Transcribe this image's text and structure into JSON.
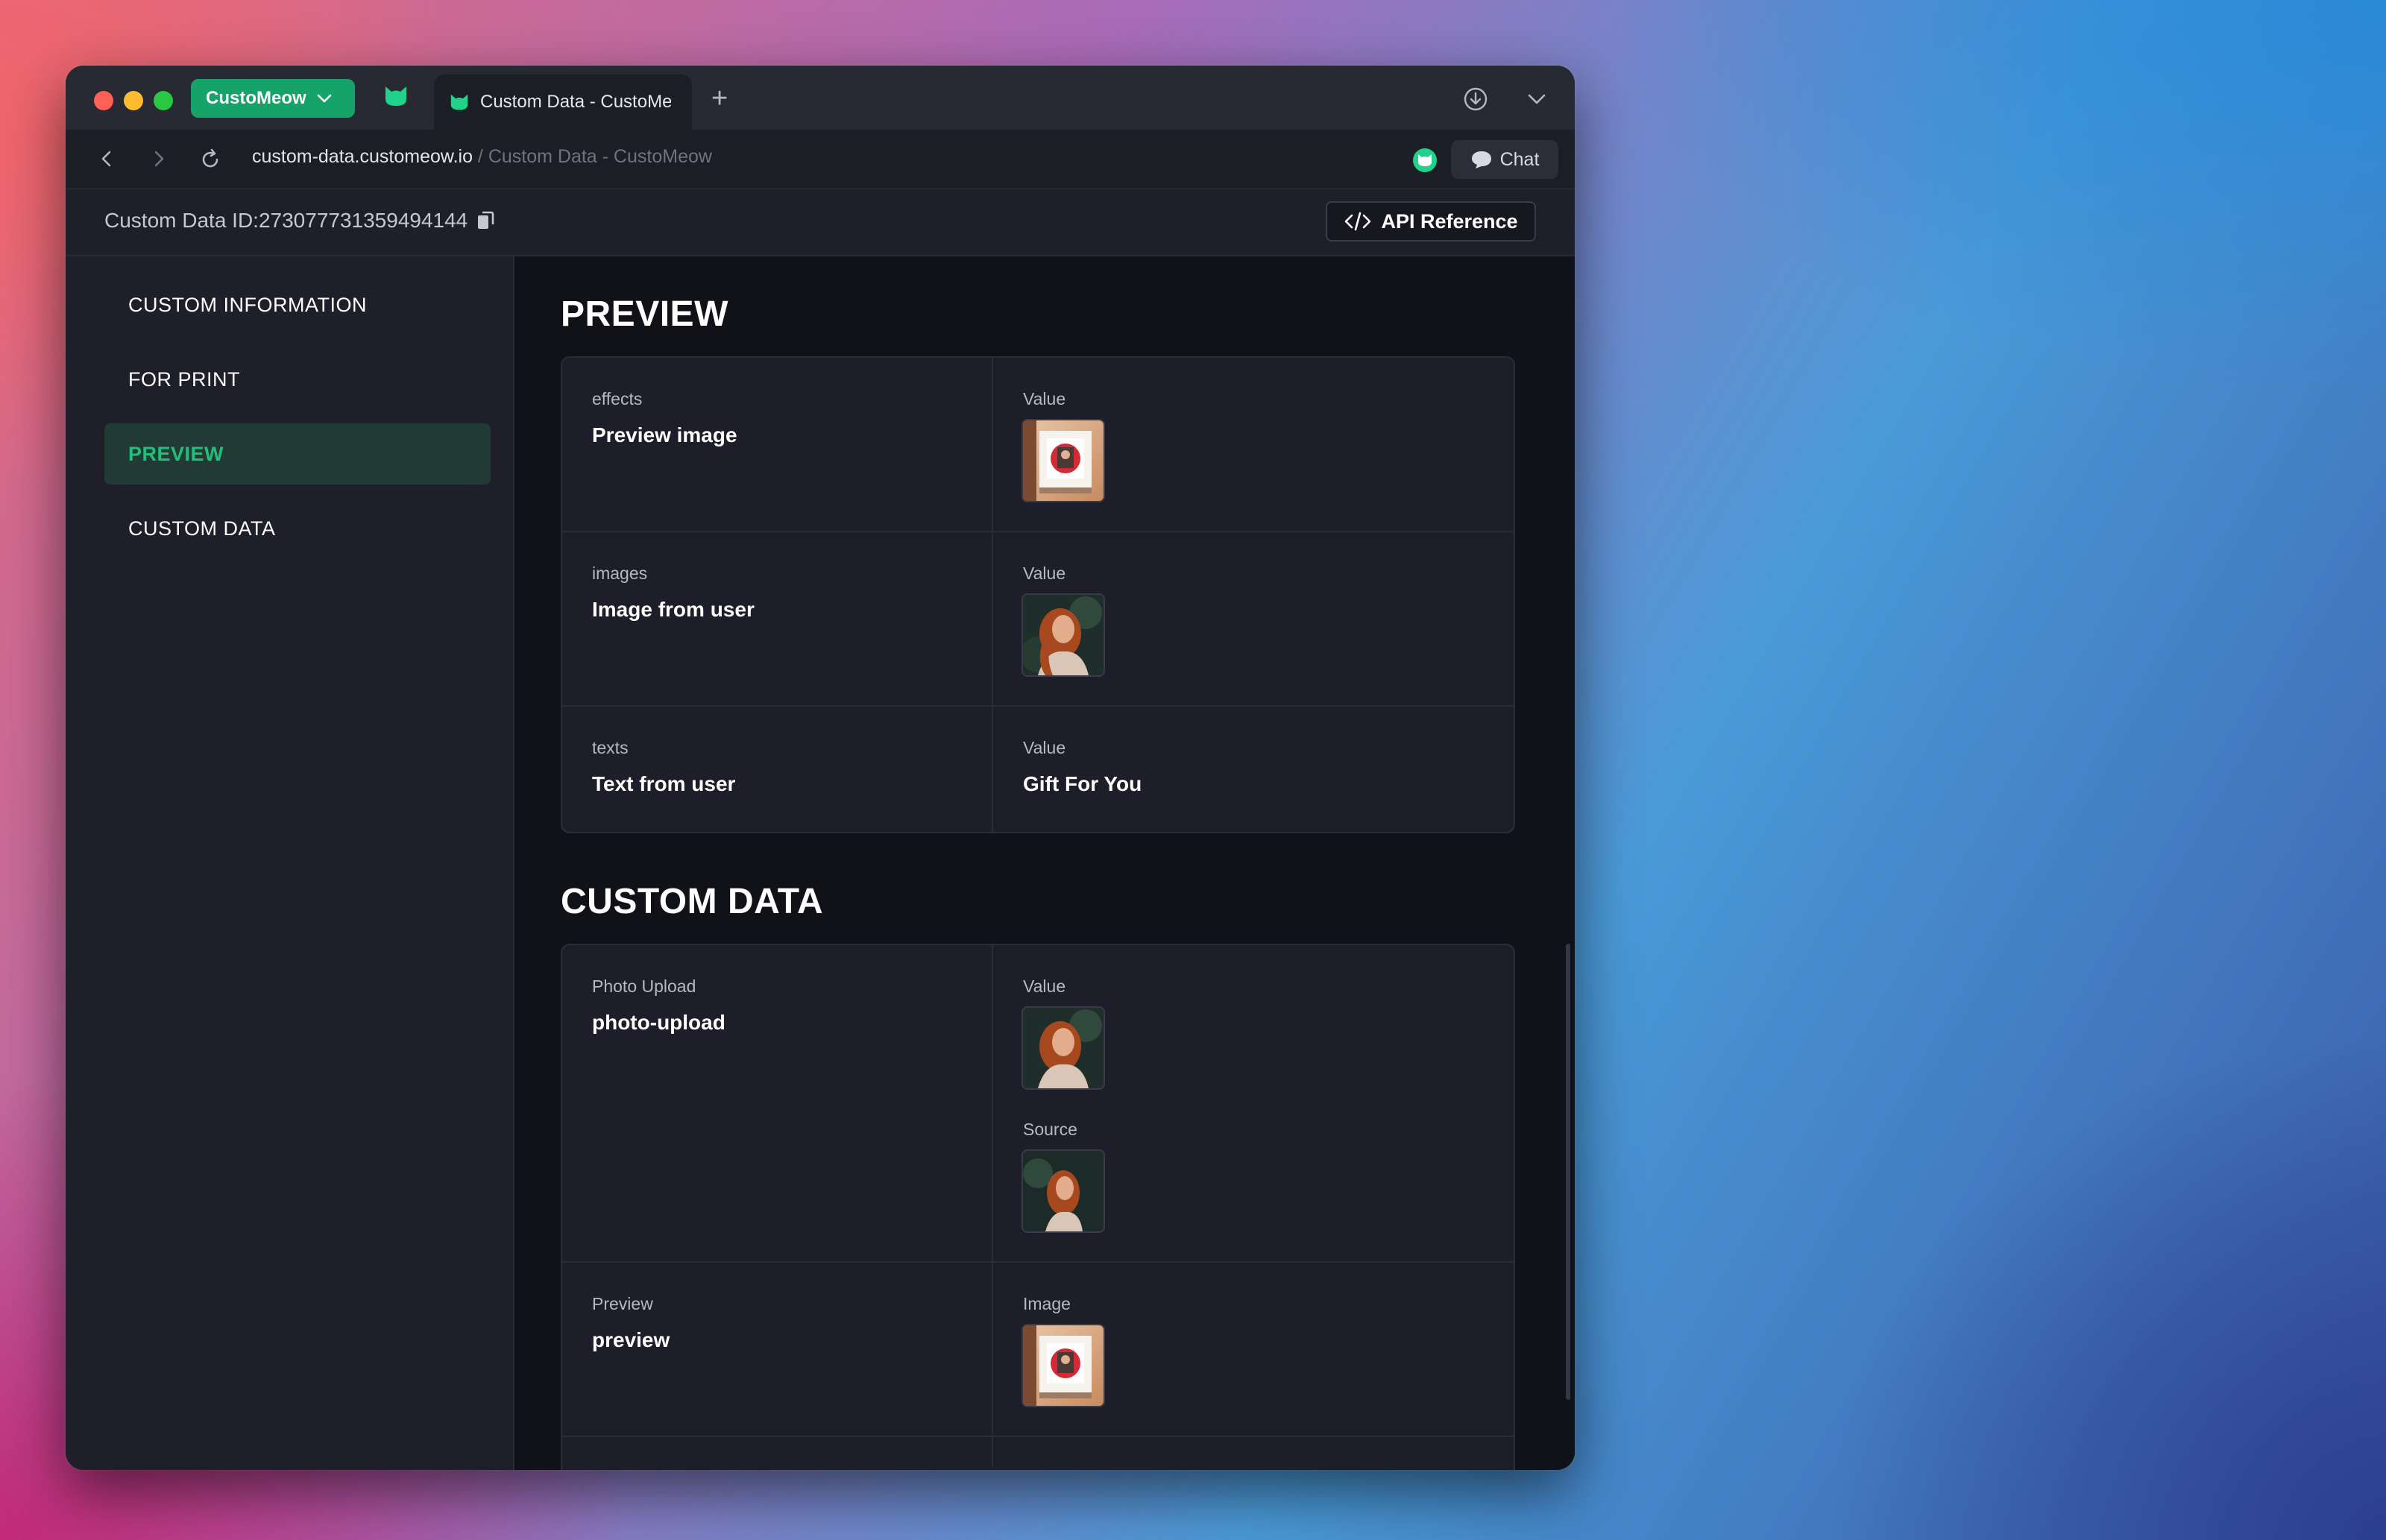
{
  "browser": {
    "profile_label": "CustoMeow",
    "tab_title": "Custom Data - CustoMeow",
    "url_host": "custom-data.customeow.io",
    "url_separator": " / ",
    "url_title": "Custom Data - CustoMeow",
    "chat_label": "Chat",
    "accent_color": "#16a36a"
  },
  "header": {
    "custom_data_id": "Custom Data ID:273077731359494144",
    "api_reference_label": "API Reference"
  },
  "sidebar": {
    "items": [
      {
        "label": "CUSTOM INFORMATION",
        "active": false
      },
      {
        "label": "FOR PRINT",
        "active": false
      },
      {
        "label": "PREVIEW",
        "active": true
      },
      {
        "label": "CUSTOM DATA",
        "active": false
      }
    ]
  },
  "preview": {
    "title": "PREVIEW",
    "rows": [
      {
        "type": "effects",
        "name": "Preview image",
        "value_label": "Value",
        "value_image": "framed-photo"
      },
      {
        "type": "images",
        "name": "Image from user",
        "value_label": "Value",
        "value_image": "portrait"
      },
      {
        "type": "texts",
        "name": "Text from user",
        "value_label": "Value",
        "value_text": "Gift For You"
      }
    ]
  },
  "custom_data": {
    "title": "CUSTOM DATA",
    "rows": [
      {
        "type": "Photo Upload",
        "name": "photo-upload",
        "value_label": "Value",
        "value_image": "portrait",
        "source_label": "Source",
        "source_image": "portrait"
      },
      {
        "type": "Preview",
        "name": "preview",
        "value_label": "Image",
        "value_image": "framed-photo"
      }
    ]
  }
}
